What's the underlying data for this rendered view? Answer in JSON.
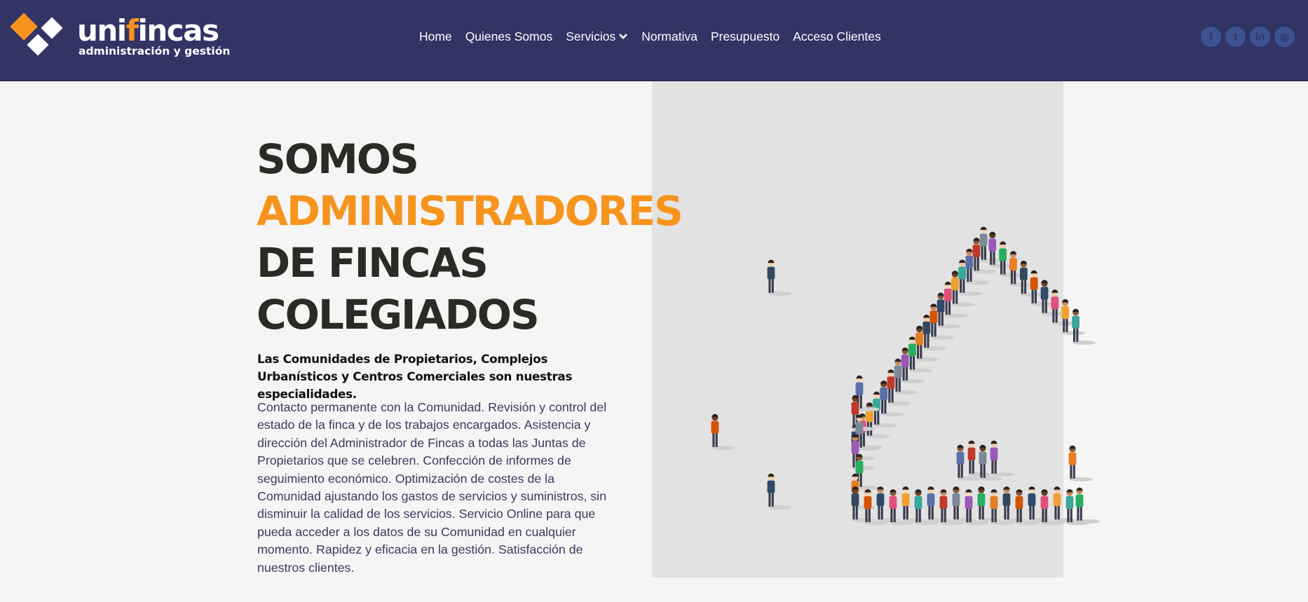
{
  "brand": {
    "name_prefix": "uni",
    "name_accent": "f",
    "name_suffix": "incas",
    "tagline": "administración y gestión",
    "colors": {
      "header_bg": "#323466",
      "accent": "#f7931e",
      "text_dark": "#2b2a24"
    }
  },
  "nav": {
    "items": [
      {
        "label": "Home"
      },
      {
        "label": "Quienes Somos"
      },
      {
        "label": "Servicios",
        "has_dropdown": true
      },
      {
        "label": "Normativa"
      },
      {
        "label": "Presupuesto"
      },
      {
        "label": "Acceso Clientes"
      }
    ]
  },
  "social": [
    {
      "icon": "facebook-icon",
      "glyph": "f"
    },
    {
      "icon": "twitter-icon",
      "glyph": "t"
    },
    {
      "icon": "linkedin-icon",
      "glyph": "in"
    },
    {
      "icon": "instagram-icon",
      "glyph": "◎"
    }
  ],
  "hero": {
    "line1": "SOMOS",
    "line2": "ADMINISTRADORES",
    "line3": "DE FINCAS",
    "line4": "COLEGIADOS",
    "lead": "Las Comunidades de Propietarios, Complejos Urbanísticos y Centros Comerciales son nuestras especialidades.",
    "body": "Contacto permanente con la Comunidad. Revisión y control del estado de la finca y de los trabajos encargados. Asistencia y dirección del Administrador de Fincas a todas las Juntas de Propietarios que se celebren. Confección de informes de seguimiento económico. Optimización de costes de la Comunidad ajustando los gastos de servicios y suministros, sin disminuir la calidad de los servicios. Servicio Online para que pueda acceder a los datos de su Comunidad en cualquier momento. Rapidez y eficacia en la gestión. Satisfacción de nuestros clientes.",
    "illustration": "people-forming-house-illustration"
  }
}
